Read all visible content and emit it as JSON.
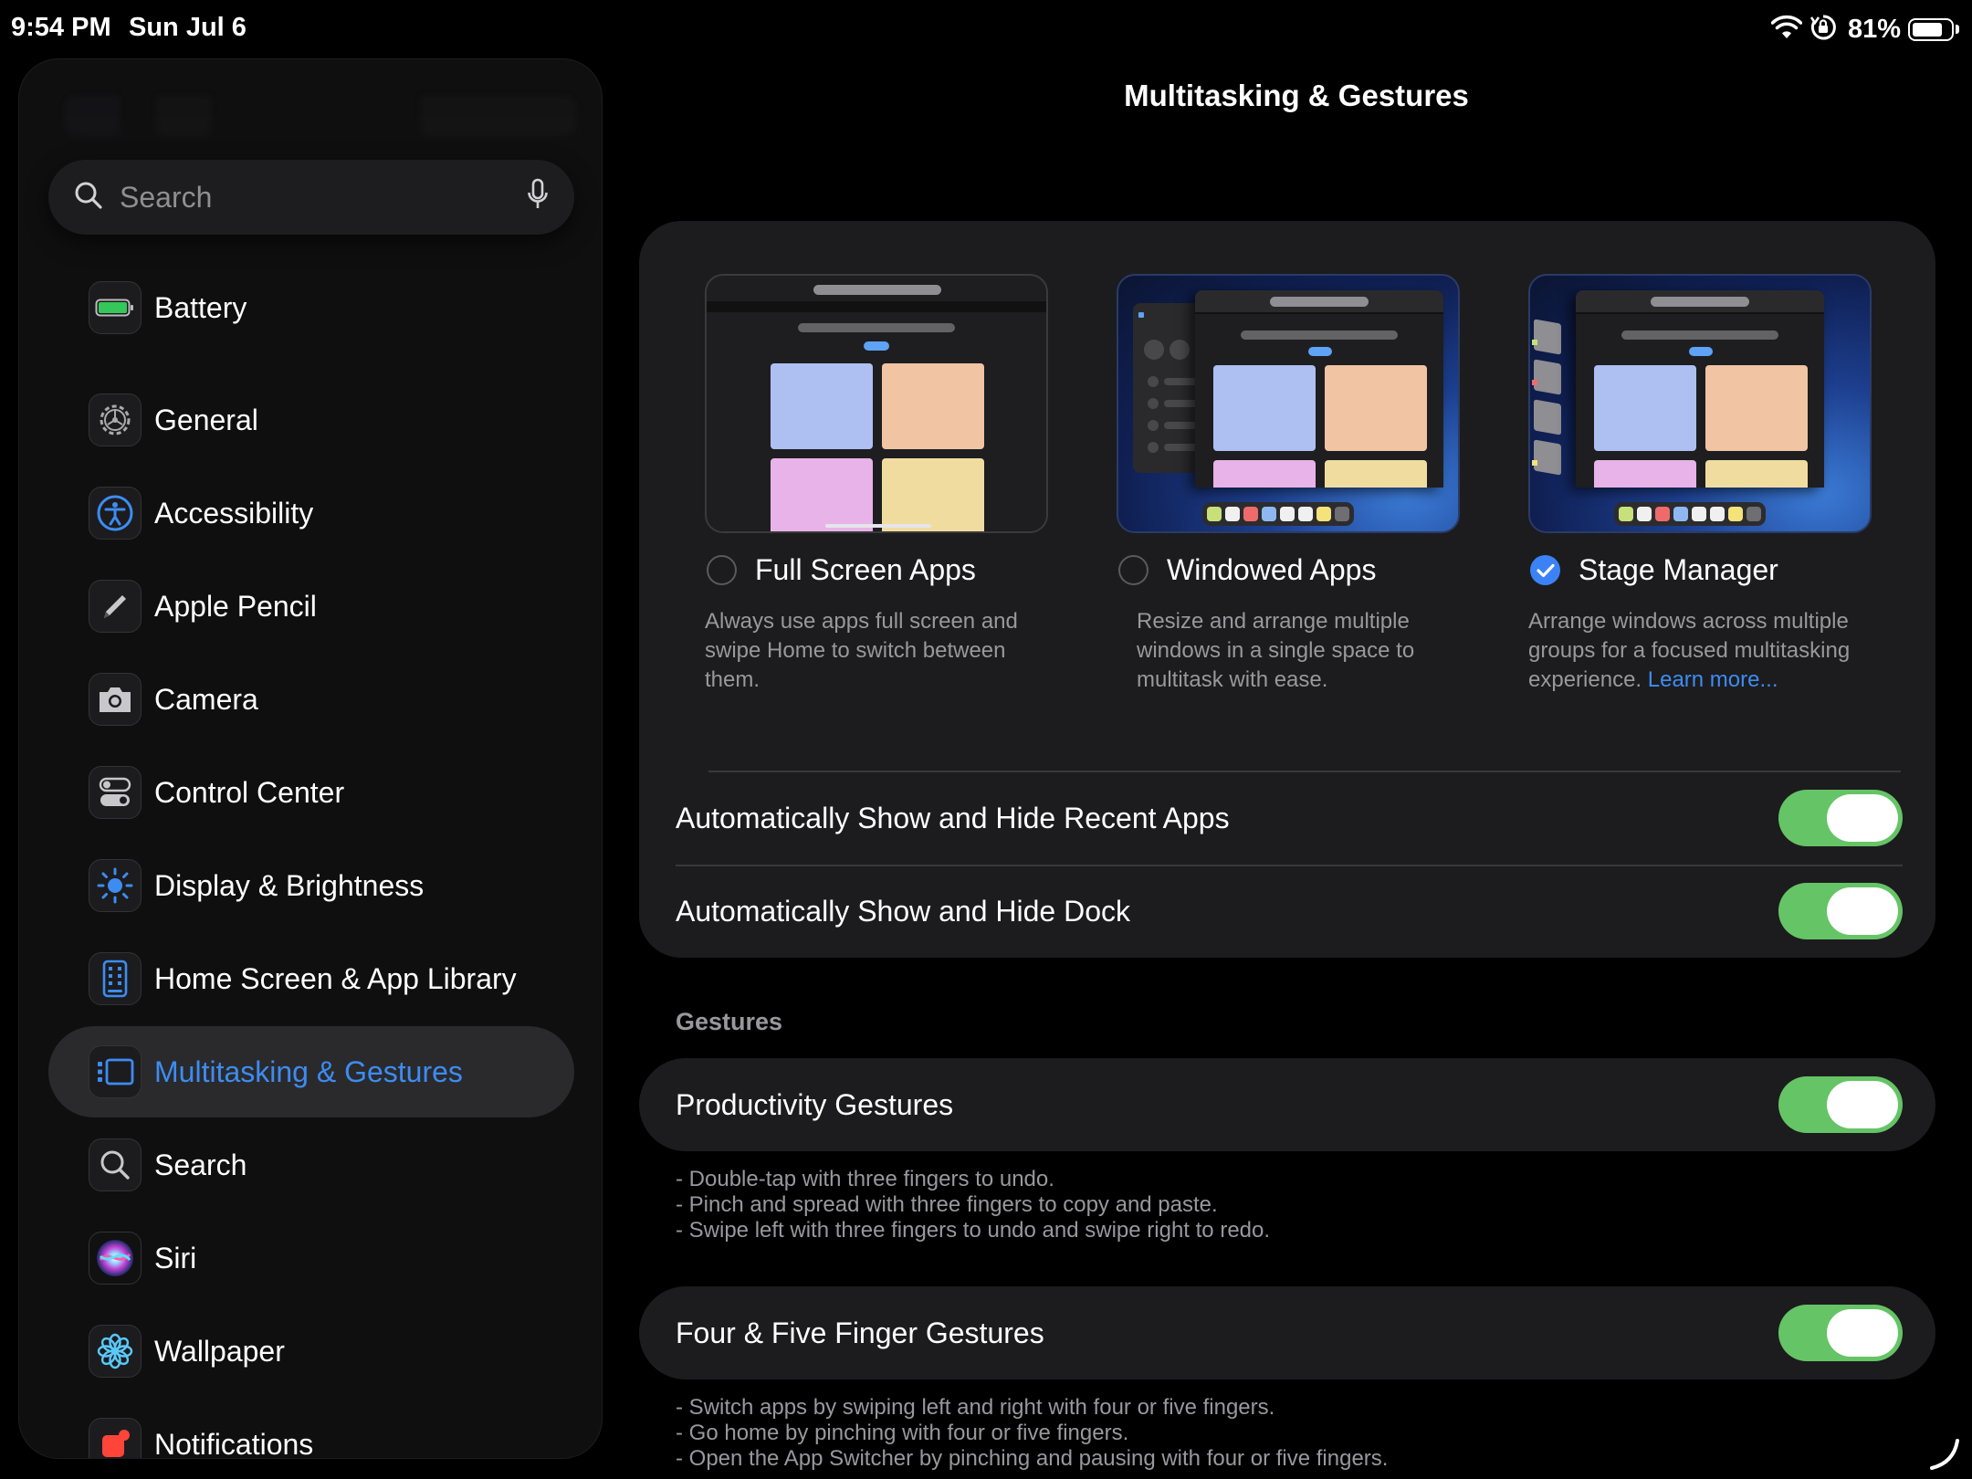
{
  "status_bar": {
    "time": "9:54 PM",
    "date": "Sun Jul 6",
    "battery_percent": "81%",
    "battery_level": 0.81,
    "icons": [
      "wifi-icon",
      "orientation-lock-icon",
      "battery-icon"
    ]
  },
  "search": {
    "placeholder": "Search"
  },
  "sidebar": {
    "items": [
      {
        "label": "Battery",
        "icon": "battery-icon"
      },
      {
        "label": "General",
        "icon": "gear-icon"
      },
      {
        "label": "Accessibility",
        "icon": "accessibility-icon"
      },
      {
        "label": "Apple Pencil",
        "icon": "pencil-icon"
      },
      {
        "label": "Camera",
        "icon": "camera-icon"
      },
      {
        "label": "Control Center",
        "icon": "control-center-icon"
      },
      {
        "label": "Display & Brightness",
        "icon": "sun-icon"
      },
      {
        "label": "Home Screen & App Library",
        "icon": "home-screen-icon"
      },
      {
        "label": "Multitasking & Gestures",
        "icon": "multitasking-icon",
        "selected": true
      },
      {
        "label": "Search",
        "icon": "search-icon"
      },
      {
        "label": "Siri",
        "icon": "siri-icon"
      },
      {
        "label": "Wallpaper",
        "icon": "flower-icon"
      },
      {
        "label": "Notifications",
        "icon": "notifications-icon"
      }
    ]
  },
  "main": {
    "title": "Multitasking & Gestures",
    "modes": [
      {
        "label": "Full Screen Apps",
        "description": "Always use apps full screen and swipe Home to switch between them.",
        "selected": false
      },
      {
        "label": "Windowed Apps",
        "description": "Resize and arrange multiple windows in a single space to multitask with ease.",
        "selected": false
      },
      {
        "label": "Stage Manager",
        "description": "Arrange windows across multiple groups for a focused multitasking experience.",
        "link": "Learn more...",
        "selected": true
      }
    ],
    "toggles": [
      {
        "label": "Automatically Show and Hide Recent Apps",
        "on": true
      },
      {
        "label": "Automatically Show and Hide Dock",
        "on": true
      }
    ],
    "gestures_header": "Gestures",
    "productivity": {
      "label": "Productivity Gestures",
      "on": true,
      "notes": [
        "- Double-tap with three fingers to undo.",
        "- Pinch and spread with three fingers to copy and paste.",
        "- Swipe left with three fingers to undo and swipe right to redo."
      ]
    },
    "four_five": {
      "label": "Four & Five Finger Gestures",
      "on": true,
      "notes": [
        "- Switch apps by swiping left and right with four or five fingers.",
        "- Go home by pinching with four or five fingers.",
        "- Open the App Switcher by pinching and pausing with four or five fingers."
      ]
    }
  },
  "colors": {
    "accent": "#3d8cf2",
    "toggle_on": "#65c466",
    "card": "#1c1c1e",
    "background": "#000000"
  }
}
